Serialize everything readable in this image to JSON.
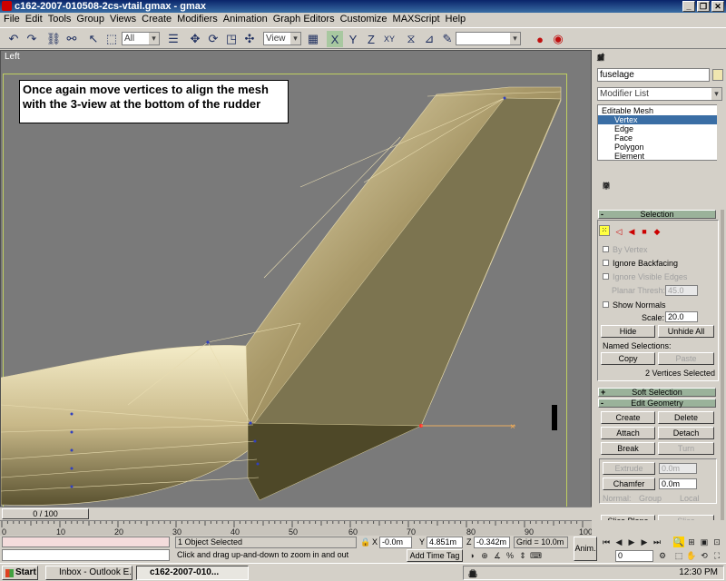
{
  "window": {
    "title": "c162-2007-010508-2cs-vtail.gmax - gmax"
  },
  "menu": [
    "File",
    "Edit",
    "Tools",
    "Group",
    "Views",
    "Create",
    "Modifiers",
    "Animation",
    "Graph Editors",
    "Customize",
    "MAXScript",
    "Help"
  ],
  "toolbar": {
    "selection_filter": "All",
    "reference_coord": "View",
    "named_selection": ""
  },
  "viewport": {
    "label": "Left",
    "annotation": "Once again move vertices to align the mesh with the 3-view at the bottom of the rudder"
  },
  "command_panel": {
    "object_name": "fuselage",
    "modifier_list": "Modifier List",
    "stack": [
      "Editable Mesh",
      "Vertex",
      "Edge",
      "Face",
      "Polygon",
      "Element"
    ],
    "selected_stack_item": "Vertex",
    "selection": {
      "title": "Selection",
      "by_vertex": "By Vertex",
      "ignore_backfacing": "Ignore Backfacing",
      "ignore_visible_edges": "Ignore Visible Edges",
      "planar_thresh_label": "Planar Thresh:",
      "planar_thresh_value": "45.0",
      "show_normals": "Show Normals",
      "scale_label": "Scale:",
      "scale_value": "20.0",
      "hide": "Hide",
      "unhide_all": "Unhide All",
      "named_selections": "Named Selections:",
      "copy": "Copy",
      "paste": "Paste",
      "status": "2 Vertices Selected"
    },
    "soft_selection": {
      "title": "Soft Selection"
    },
    "edit_geometry": {
      "title": "Edit Geometry",
      "create": "Create",
      "delete": "Delete",
      "attach": "Attach",
      "detach": "Detach",
      "break": "Break",
      "turn": "Turn",
      "extrude": "Extrude",
      "extrude_value": "0.0m",
      "chamfer": "Chamfer",
      "chamfer_value": "0.0m",
      "normal_label": "Normal:",
      "group": "Group",
      "local": "Local",
      "slice_plane": "Slice Plane",
      "slice": "Slice"
    }
  },
  "timeline": {
    "slider": "0 / 100",
    "ticks": [
      "0",
      "10",
      "20",
      "30",
      "40",
      "50",
      "60",
      "70",
      "80",
      "90",
      "100"
    ]
  },
  "status": {
    "selected": "1 Object Selected",
    "prompt": "Click and drag up-and-down to zoom in and out",
    "x_value": "-0.0m",
    "y_value": "4.851m",
    "z_value": "-0.342m",
    "grid": "Grid = 10.0m",
    "add_time_tag": "Add Time Tag",
    "anim": "Anim.",
    "frame": "0",
    "x_label": "X",
    "y_label": "Y",
    "z_label": "Z"
  },
  "taskbar": {
    "start": "Start",
    "tasks": [
      "Inbox - Outlook E...",
      "c162-2007-010..."
    ],
    "clock": "12:30 PM"
  },
  "colors": {
    "mesh_surface": "#8a8055",
    "mesh_highlight": "#e8dcb0",
    "viewport_bg": "#7a7a7a",
    "selected_vertex": "#ff3030",
    "stack_selected": "#3a6ea5"
  }
}
